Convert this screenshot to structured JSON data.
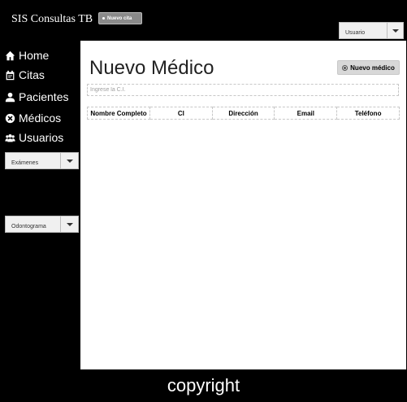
{
  "header": {
    "brand": "SIS Consultas TB",
    "new_cita_label": "Nuevo cita",
    "user_dropdown_label": "Usuario"
  },
  "sidebar": {
    "items": [
      {
        "label": "Home",
        "icon": "home-icon"
      },
      {
        "label": "Citas",
        "icon": "calendar-icon"
      },
      {
        "label": "Pacientes",
        "icon": "person-icon"
      },
      {
        "label": "Médicos",
        "icon": "medical-icon"
      },
      {
        "label": "Usuarios",
        "icon": "users-icon"
      }
    ],
    "dropdowns": [
      {
        "label": "Exámenes"
      },
      {
        "label": "Odontograma"
      }
    ]
  },
  "main": {
    "title": "Nuevo Médico",
    "new_button_label": "Nuevo médico",
    "search_placeholder": "Ingrese la C.I.",
    "table_headers": [
      "Nombre Completo",
      "CI",
      "Dirección",
      "Email",
      "Teléfono"
    ]
  },
  "footer": {
    "text": "copyright"
  }
}
